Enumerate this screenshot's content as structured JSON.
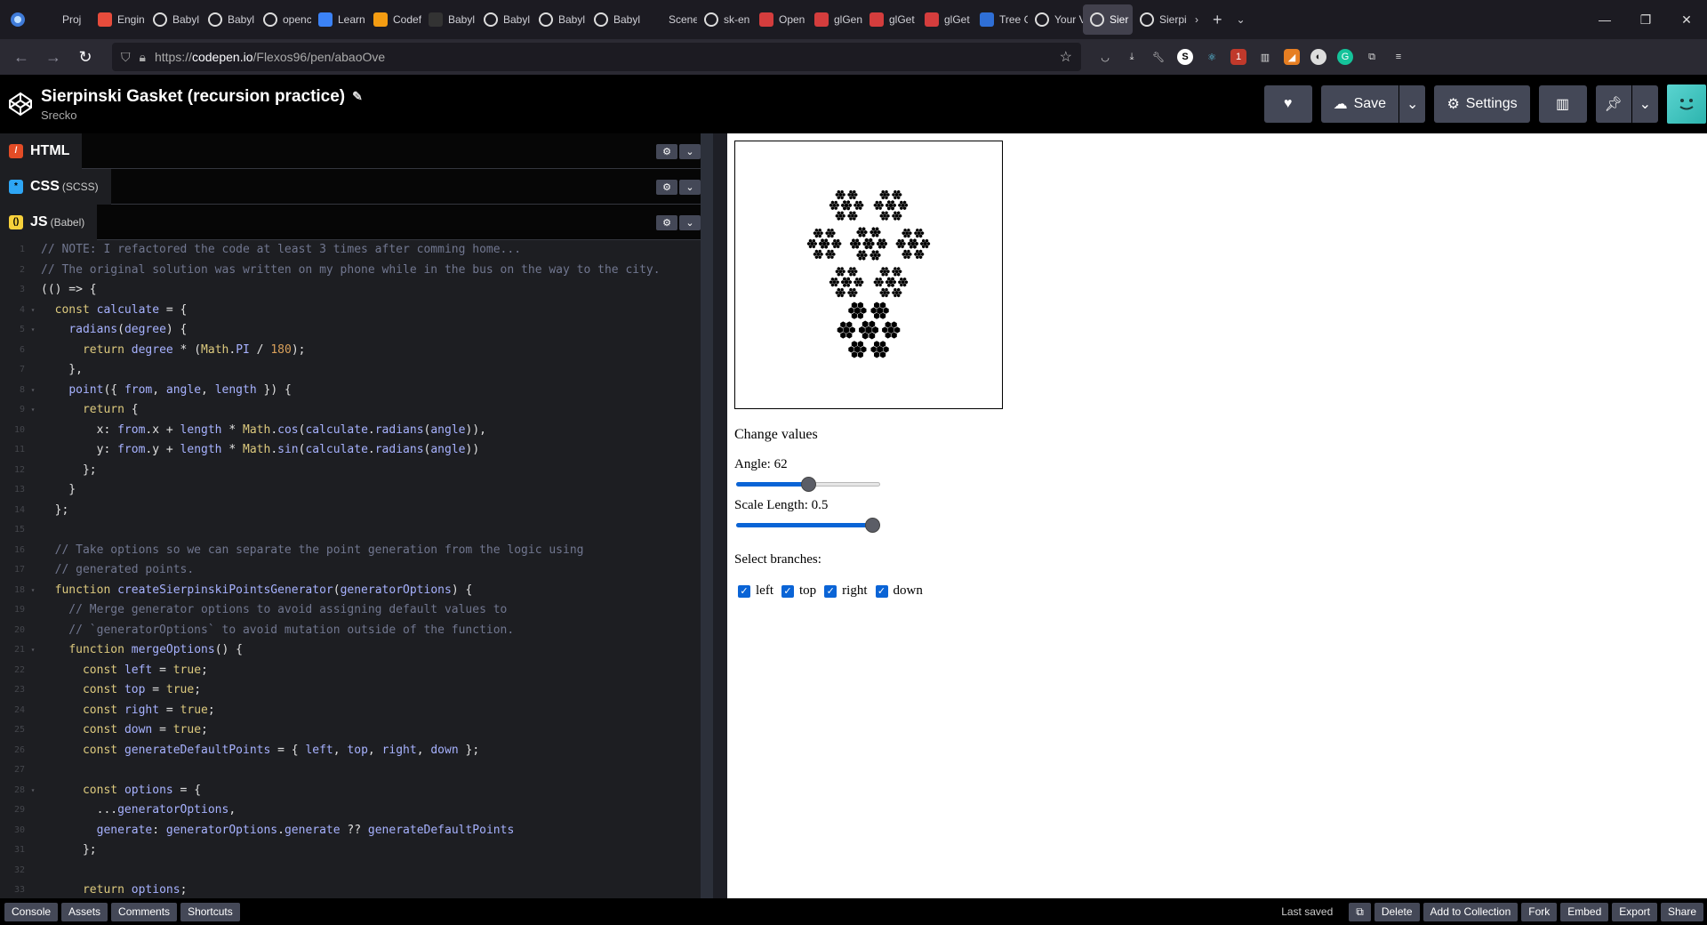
{
  "browser": {
    "tabs": [
      {
        "label": "Proj",
        "icon": "arrow-left-icon",
        "color": "#1c1b22"
      },
      {
        "label": "Engin",
        "icon": "red-dot-icon",
        "color": "#e74c3c"
      },
      {
        "label": "Babyl",
        "icon": "github-icon",
        "color": "#ffffff"
      },
      {
        "label": "Babyl",
        "icon": "github-icon",
        "color": "#ffffff"
      },
      {
        "label": "openc",
        "icon": "google-icon",
        "color": "#ffffff"
      },
      {
        "label": "Learn",
        "icon": "learn-icon",
        "color": "#3b82f6"
      },
      {
        "label": "Codef",
        "icon": "bar-chart-icon",
        "color": "#f39c12"
      },
      {
        "label": "Babyl",
        "icon": "babylon-icon",
        "color": "#333333"
      },
      {
        "label": "Babyl",
        "icon": "github-icon",
        "color": "#ffffff"
      },
      {
        "label": "Babyl",
        "icon": "github-icon",
        "color": "#ffffff"
      },
      {
        "label": "Babyl",
        "icon": "github-icon",
        "color": "#ffffff"
      },
      {
        "label": "Scene-Eng",
        "icon": "blank-icon",
        "color": "#1c1b22"
      },
      {
        "label": "sk-en",
        "icon": "github-icon",
        "color": "#ffffff"
      },
      {
        "label": "Open",
        "icon": "khronos-icon",
        "color": "#d43d3d"
      },
      {
        "label": "glGen",
        "icon": "khronos-icon",
        "color": "#d43d3d"
      },
      {
        "label": "glGet",
        "icon": "khronos-icon",
        "color": "#d43d3d"
      },
      {
        "label": "glGet",
        "icon": "khronos-icon",
        "color": "#d43d3d"
      },
      {
        "label": "Tree G",
        "icon": "3d-icon",
        "color": "#2f6fd6"
      },
      {
        "label": "Your V",
        "icon": "codepen-icon",
        "color": "#ffffff"
      },
      {
        "label": "Sier",
        "icon": "codepen-icon",
        "color": "#ffffff",
        "active": true
      },
      {
        "label": "Sierpi",
        "icon": "codepen-icon",
        "color": "#ffffff"
      }
    ],
    "url_prefix": "https://",
    "url_main": "codepen.io",
    "url_path": "/Flexos96/pen/abaoOve"
  },
  "header": {
    "title": "Sierpinski Gasket (recursion practice)",
    "author": "Srecko",
    "save_label": "Save",
    "settings_label": "Settings"
  },
  "panels": {
    "html": {
      "label": "HTML",
      "sub": ""
    },
    "css": {
      "label": "CSS",
      "sub": "(SCSS)"
    },
    "js": {
      "label": "JS",
      "sub": "(Babel)"
    }
  },
  "code_lines": [
    "// NOTE: I refactored the code at least 3 times after comming home...",
    "// The original solution was written on my phone while in the bus on the way to the city.",
    "(() => {",
    "  const calculate = {",
    "    radians(degree) {",
    "      return degree * (Math.PI / 180);",
    "    },",
    "    point({ from, angle, length }) {",
    "      return {",
    "        x: from.x + length * Math.cos(calculate.radians(angle)),",
    "        y: from.y + length * Math.sin(calculate.radians(angle))",
    "      };",
    "    }",
    "  };",
    "",
    "  // Take options so we can separate the point generation from the logic using",
    "  // generated points.",
    "  function createSierpinskiPointsGenerator(generatorOptions) {",
    "    // Merge generator options to avoid assigning default values to",
    "    // `generatorOptions` to avoid mutation outside of the function.",
    "    function mergeOptions() {",
    "      const left = true;",
    "      const top = true;",
    "      const right = true;",
    "      const down = true;",
    "      const generateDefaultPoints = { left, top, right, down };",
    "",
    "      const options = {",
    "        ...generatorOptions,",
    "        generate: generatorOptions.generate ?? generateDefaultPoints",
    "      };",
    "",
    "      return options;"
  ],
  "preview": {
    "heading": "Change values",
    "angle_label": "Angle: 62",
    "angle_value": 62,
    "angle_fraction": 0.5,
    "scale_label": "Scale Length: 0.5",
    "scale_value": 0.5,
    "scale_fraction": 1.0,
    "branches_label": "Select branches:",
    "branches": [
      "left",
      "top",
      "right",
      "down"
    ]
  },
  "footer": {
    "left_buttons": [
      "Console",
      "Assets",
      "Comments",
      "Shortcuts"
    ],
    "last_saved": "Last saved",
    "right_buttons": [
      "Delete",
      "Add to Collection",
      "Fork",
      "Embed",
      "Export",
      "Share"
    ]
  },
  "colors": {
    "html_badge": "#e34c26",
    "css_badge": "#2ea6f5",
    "js_badge": "#f7d13b",
    "slider_fill": "#0a64d6"
  }
}
